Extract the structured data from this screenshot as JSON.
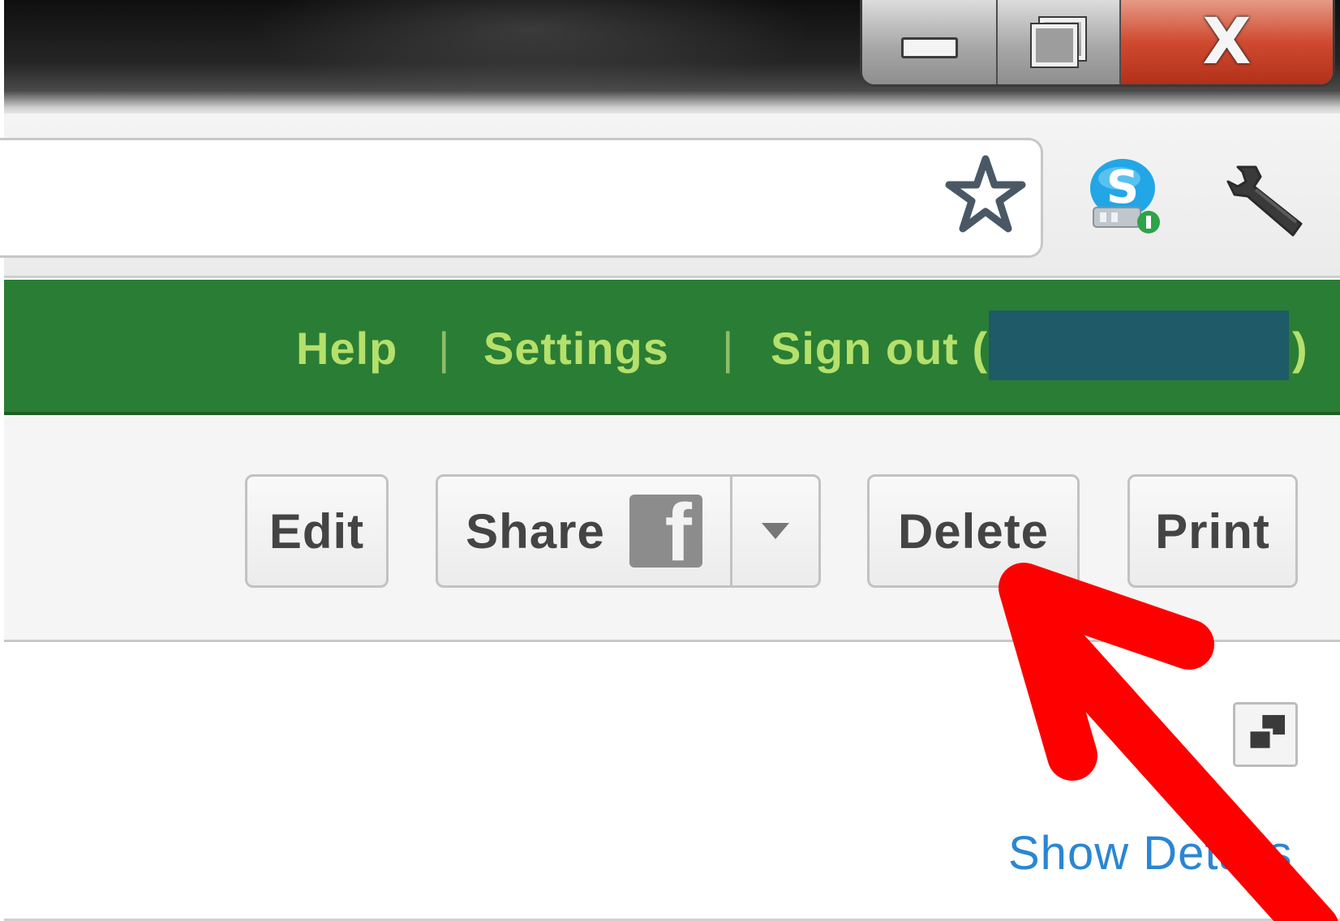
{
  "window_controls": {
    "close_glyph": "X"
  },
  "account_bar": {
    "background": "#2a7d34",
    "link_color": "#b5e06b",
    "help": "Help",
    "separator": "|",
    "settings": "Settings",
    "sign_out": "Sign out (",
    "closing_paren": ")"
  },
  "actions": {
    "edit": "Edit",
    "share": "Share",
    "facebook_letter": "f",
    "delete": "Delete",
    "print": "Print"
  },
  "content": {
    "show_details": "Show Details"
  },
  "annotation": {
    "arrow_color": "#ff0000",
    "target": "Delete"
  },
  "icons": [
    "minimize-icon",
    "restore-icon",
    "close-icon",
    "star-icon",
    "skype-icon",
    "wrench-icon",
    "facebook-icon",
    "dropdown-caret-icon",
    "popout-icon",
    "red-arrow"
  ]
}
